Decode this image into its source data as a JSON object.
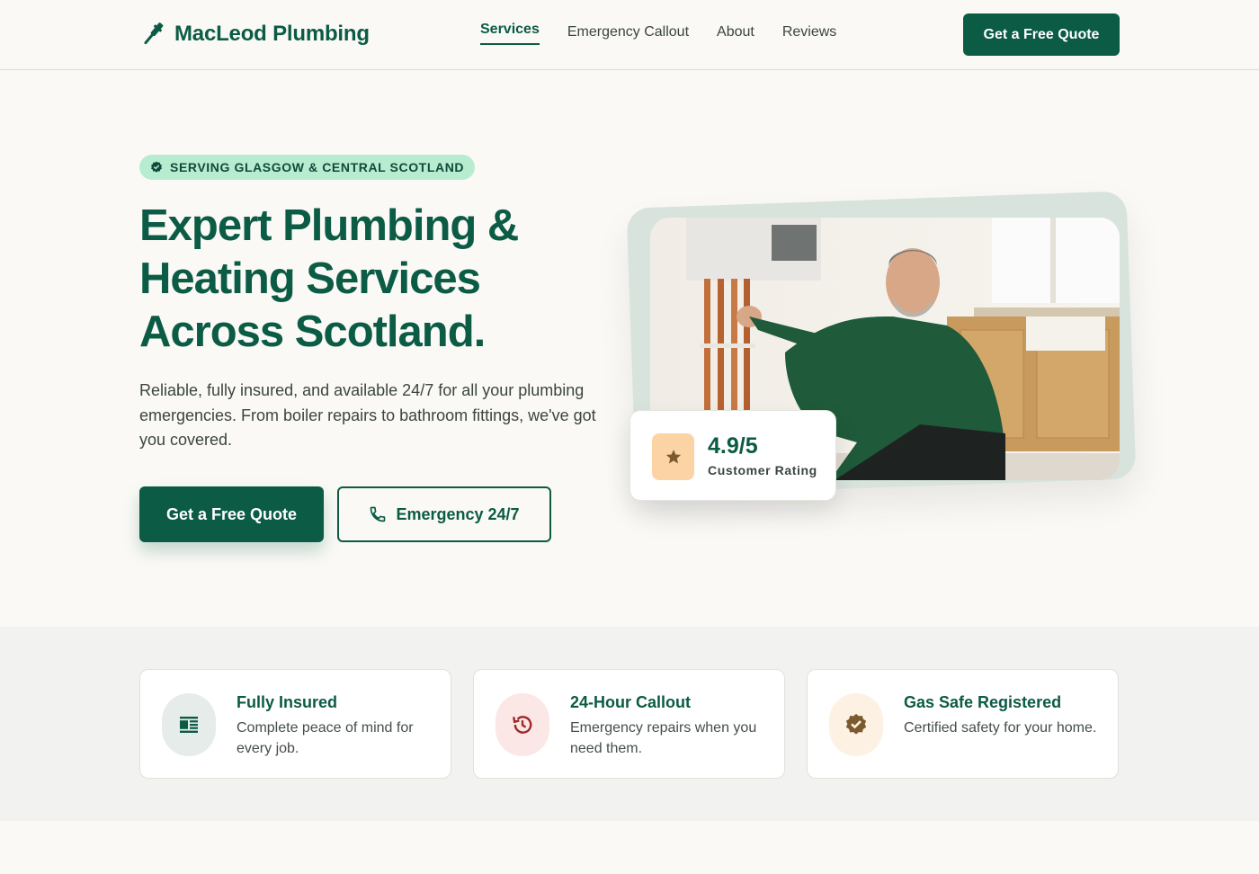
{
  "header": {
    "brand": "MacLeod Plumbing",
    "nav": [
      {
        "label": "Services",
        "active": true
      },
      {
        "label": "Emergency Callout",
        "active": false
      },
      {
        "label": "About",
        "active": false
      },
      {
        "label": "Reviews",
        "active": false
      }
    ],
    "cta_label": "Get a Free Quote",
    "logo_icon": "wrench-icon"
  },
  "hero": {
    "badge": "SERVING GLASGOW & CENTRAL SCOTLAND",
    "badge_icon": "verified-icon",
    "title_lines": [
      "Expert Plumbing &",
      "Heating Services",
      "Across Scotland."
    ],
    "description": "Reliable, fully insured, and available 24/7 for all your plumbing emergencies. From boiler repairs to bathroom fittings, we've got you covered.",
    "primary_cta": "Get a Free Quote",
    "secondary_cta": "Emergency 24/7",
    "secondary_icon": "phone-icon"
  },
  "rating": {
    "value": "4.9/5",
    "label": "Customer Rating",
    "icon": "star-icon"
  },
  "features": [
    {
      "title": "Fully Insured",
      "description": "Complete peace of mind for every job.",
      "icon": "policy-icon",
      "icon_bg": "#e6ece9",
      "icon_color": "#0b5b45"
    },
    {
      "title": "24-Hour Callout",
      "description": "Emergency repairs when you need them.",
      "icon": "history-icon",
      "icon_bg": "#fbe7e6",
      "icon_color": "#a02626"
    },
    {
      "title": "Gas Safe Registered",
      "description": "Certified safety for your home.",
      "icon": "verified-badge-icon",
      "icon_bg": "#fdf1e4",
      "icon_color": "#7a5a2e"
    }
  ],
  "colors": {
    "brand": "#0b5b45",
    "background": "#faf9f6",
    "badge": "#b8ecd0",
    "rating_icon_bg": "#fcd3a4"
  }
}
